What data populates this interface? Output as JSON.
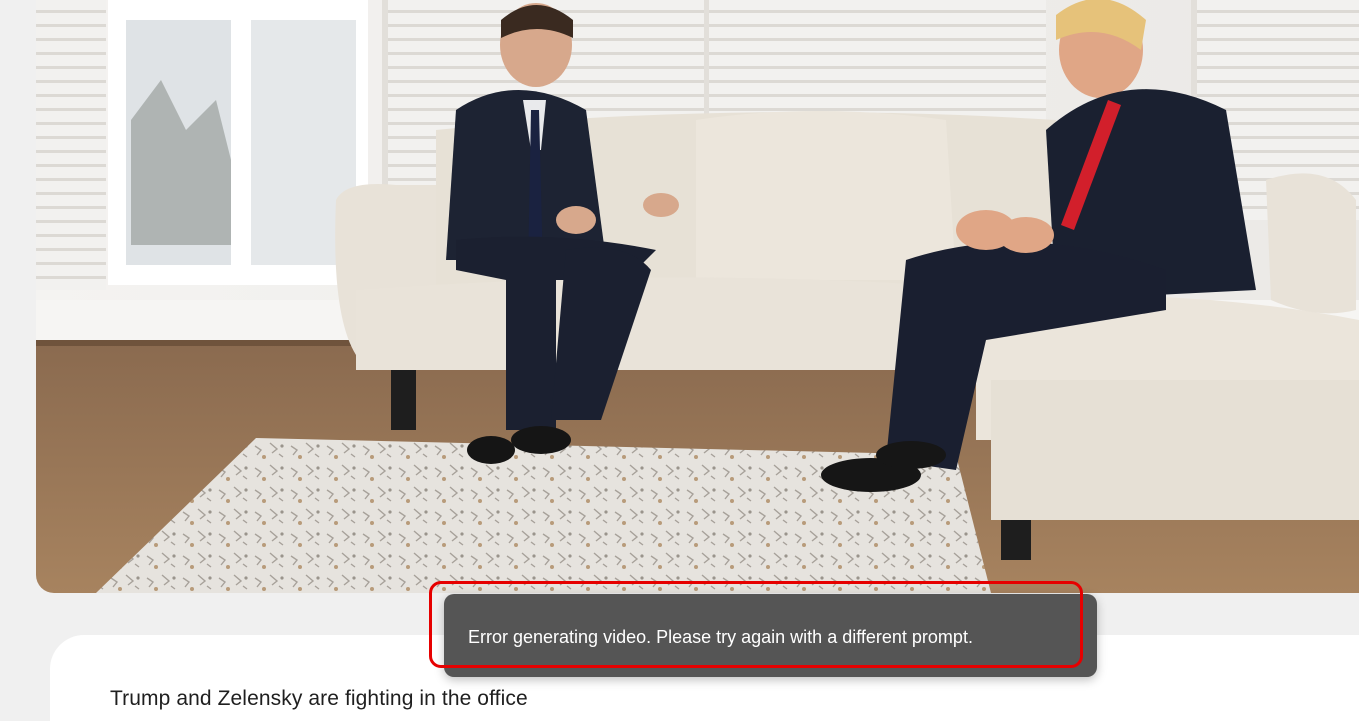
{
  "image": {
    "icon": "generated-image"
  },
  "toast": {
    "message": "Error generating video. Please try again with a different prompt.",
    "highlight_color": "#e60000"
  },
  "prompt": {
    "text": "Trump and Zelensky are fighting in the office"
  }
}
